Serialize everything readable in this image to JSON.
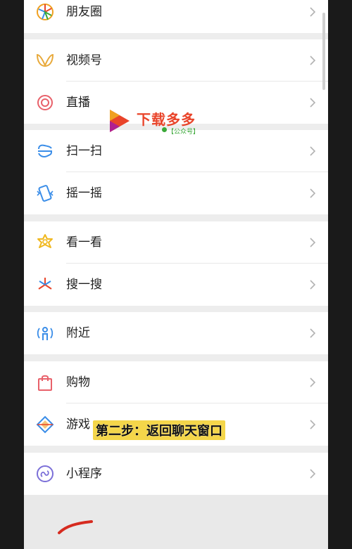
{
  "menu": {
    "items": [
      {
        "label": "朋友圈",
        "icon": "moments-icon"
      },
      {
        "label": "视频号",
        "icon": "channels-icon"
      },
      {
        "label": "直播",
        "icon": "live-icon"
      },
      {
        "label": "扫一扫",
        "icon": "scan-icon"
      },
      {
        "label": "摇一摇",
        "icon": "shake-icon"
      },
      {
        "label": "看一看",
        "icon": "top-stories-icon"
      },
      {
        "label": "搜一搜",
        "icon": "search-icon"
      },
      {
        "label": "附近",
        "icon": "nearby-icon"
      },
      {
        "label": "购物",
        "icon": "shopping-icon"
      },
      {
        "label": "游戏",
        "icon": "games-icon"
      },
      {
        "label": "小程序",
        "icon": "mini-programs-icon"
      }
    ]
  },
  "watermark": {
    "title": "下载多多",
    "subtitle": "【公众号】"
  },
  "caption": {
    "text": "第二步：返回聊天窗口"
  },
  "colors": {
    "background": "#ededed",
    "item_bg": "#ffffff",
    "chevron": "#b2b2b2",
    "caption_bg": "#f4d64a",
    "watermark_red": "#e9442a",
    "stroke_red": "#d62b1f"
  }
}
